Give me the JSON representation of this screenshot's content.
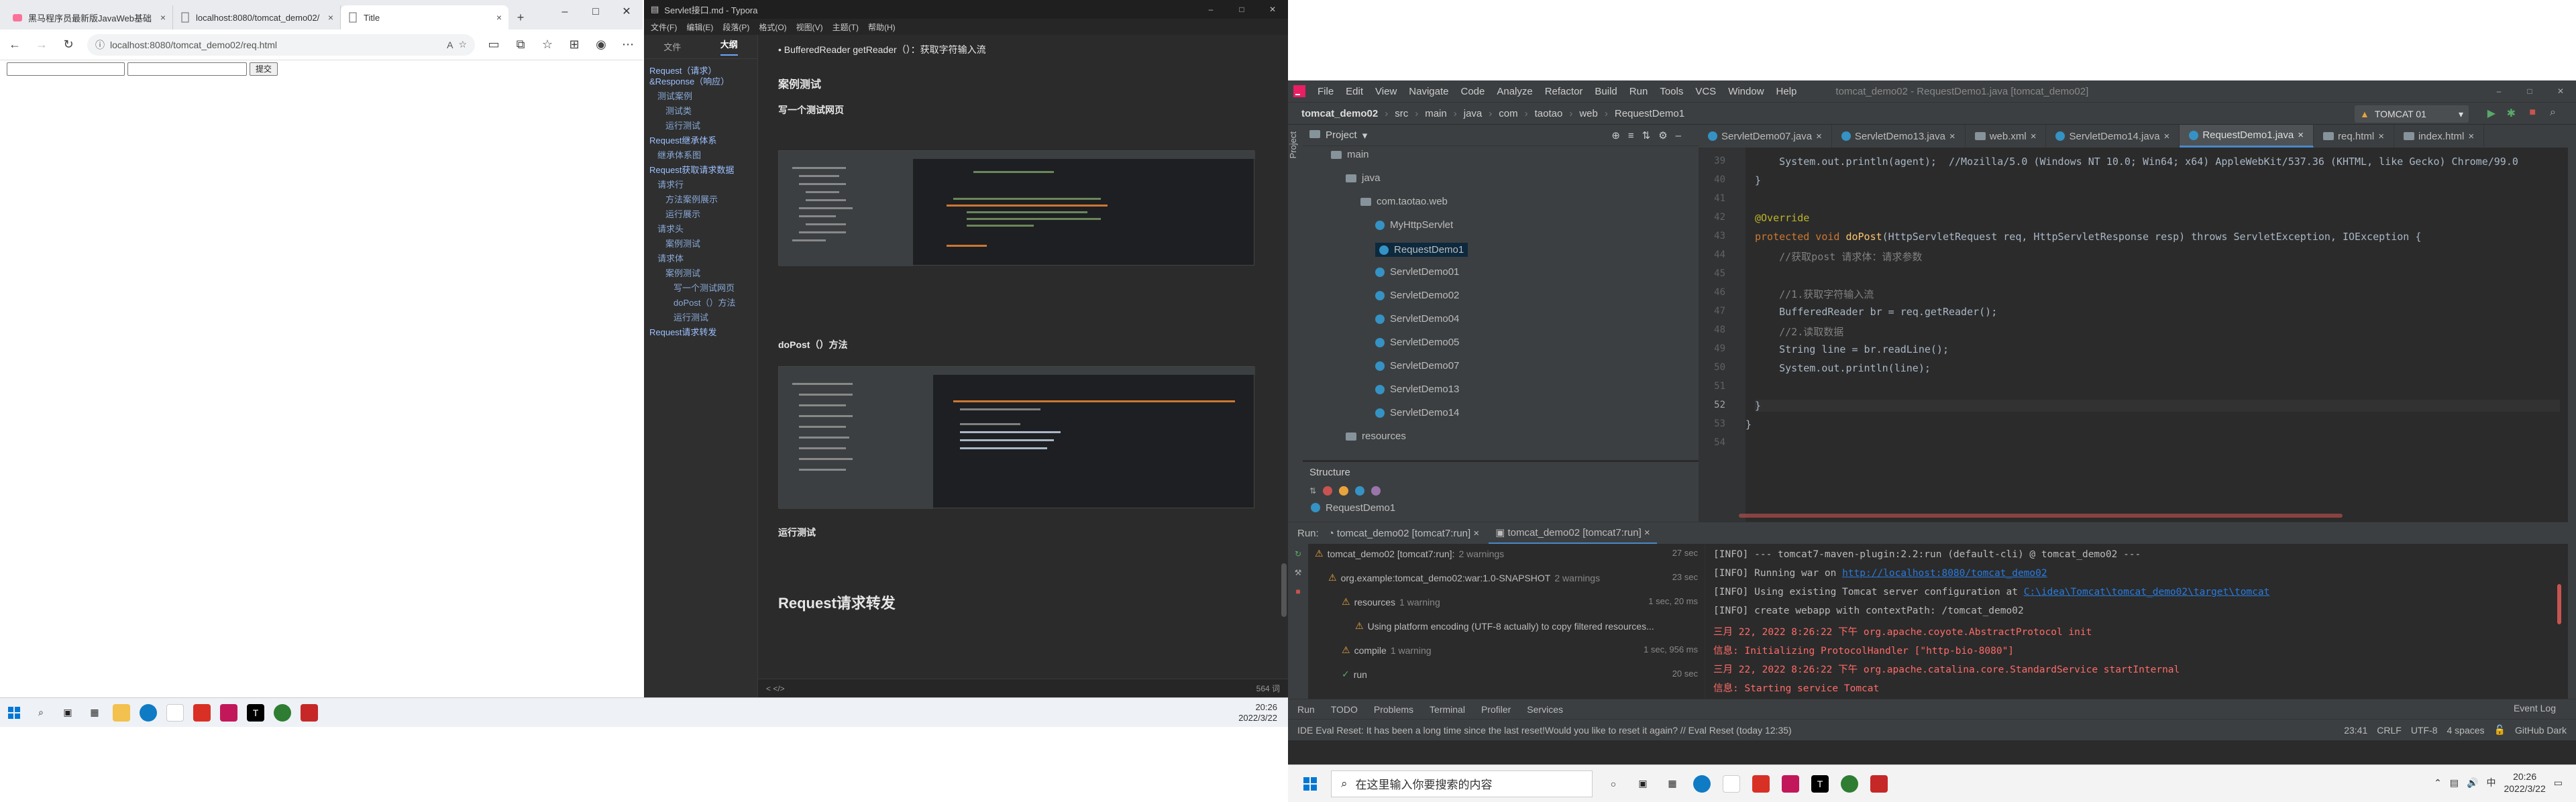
{
  "browser": {
    "tabs": [
      {
        "title": "黑马程序员最新版JavaWeb基础",
        "icon": "bilibili-icon"
      },
      {
        "title": "localhost:8080/tomcat_demo02/",
        "icon": "page-icon"
      },
      {
        "title": "Title",
        "icon": "page-icon"
      }
    ],
    "new_tab": "+",
    "address": "localhost:8080/tomcat_demo02/req.html",
    "submit_label": "提交"
  },
  "typora": {
    "title": "Servlet接口.md - Typora",
    "menu": [
      "文件(F)",
      "编辑(E)",
      "段落(P)",
      "格式(O)",
      "视图(V)",
      "主题(T)",
      "帮助(H)"
    ],
    "side_tabs": [
      "文件",
      "大纲"
    ],
    "outline": [
      {
        "text": "Request（请求）&Response（响应）",
        "level": 0
      },
      {
        "text": "测试案例",
        "level": 1
      },
      {
        "text": "测试类",
        "level": 2
      },
      {
        "text": "运行测试",
        "level": 2
      },
      {
        "text": "Request继承体系",
        "level": 0
      },
      {
        "text": "继承体系图",
        "level": 1
      },
      {
        "text": "Request获取请求数据",
        "level": 0
      },
      {
        "text": "请求行",
        "level": 1
      },
      {
        "text": "方法案例展示",
        "level": 2
      },
      {
        "text": "运行展示",
        "level": 2
      },
      {
        "text": "请求头",
        "level": 1
      },
      {
        "text": "案例测试",
        "level": 2
      },
      {
        "text": "请求体",
        "level": 1
      },
      {
        "text": "案例测试",
        "level": 2
      },
      {
        "text": "写一个测试网页",
        "level": 3
      },
      {
        "text": "doPost（）方法",
        "level": 3
      },
      {
        "text": "运行测试",
        "level": 3
      },
      {
        "text": "Request请求转发",
        "level": 0
      }
    ],
    "doc": {
      "bullet": "BufferedReader getReader（）：获取字符输入流",
      "h_case": "案例测试",
      "h_web": "写一个测试网页",
      "h_dopost": "doPost（）方法",
      "h_run": "运行测试",
      "h_forward": "Request请求转发"
    },
    "status_words": "564 词",
    "status_left": "< </>"
  },
  "taskbar_small": {
    "time": "20:26",
    "date": "2022/3/22"
  },
  "ide": {
    "menu": [
      "File",
      "Edit",
      "View",
      "Navigate",
      "Code",
      "Analyze",
      "Refactor",
      "Build",
      "Run",
      "Tools",
      "VCS",
      "Window",
      "Help"
    ],
    "window_title": "tomcat_demo02 - RequestDemo1.java [tomcat_demo02]",
    "breadcrumb": [
      "tomcat_demo02",
      "src",
      "main",
      "java",
      "com",
      "taotao",
      "web",
      "RequestDemo1"
    ],
    "run_config": "TOMCAT 01",
    "project_label": "Project",
    "tree": [
      {
        "label": "main",
        "kind": "folder",
        "indent": 1
      },
      {
        "label": "java",
        "kind": "folder",
        "indent": 2
      },
      {
        "label": "com.taotao.web",
        "kind": "folder",
        "indent": 3
      },
      {
        "label": "MyHttpServlet",
        "kind": "class",
        "indent": 4
      },
      {
        "label": "RequestDemo1",
        "kind": "class",
        "indent": 4
      },
      {
        "label": "ServletDemo01",
        "kind": "class",
        "indent": 4
      },
      {
        "label": "ServletDemo02",
        "kind": "class",
        "indent": 4
      },
      {
        "label": "ServletDemo04",
        "kind": "class",
        "indent": 4
      },
      {
        "label": "ServletDemo05",
        "kind": "class",
        "indent": 4
      },
      {
        "label": "ServletDemo07",
        "kind": "class",
        "indent": 4
      },
      {
        "label": "ServletDemo13",
        "kind": "class",
        "indent": 4
      },
      {
        "label": "ServletDemo14",
        "kind": "class",
        "indent": 4
      },
      {
        "label": "resources",
        "kind": "folder",
        "indent": 2
      }
    ],
    "structure_label": "Structure",
    "structure_item": "RequestDemo1",
    "editor_tabs": [
      "ServletDemo07.java",
      "ServletDemo13.java",
      "web.xml",
      "ServletDemo14.java",
      "RequestDemo1.java",
      "req.html",
      "index.html"
    ],
    "active_tab": "RequestDemo1.java",
    "line_numbers": [
      "39",
      "40",
      "41",
      "42",
      "43",
      "44",
      "45",
      "46",
      "47",
      "48",
      "49",
      "50",
      "51",
      "52",
      "53",
      "54"
    ],
    "code": {
      "l39": "    System.out.println(agent);  //Mozilla/5.0 (Windows NT 10.0; Win64; x64) AppleWebKit/537.36 (KHTML, like Gecko) Chrome/99.0",
      "l40": "}",
      "l42": "@Override",
      "l43a": "protected void ",
      "l43b": "doPost",
      "l43c": "(HttpServletRequest req, HttpServletResponse resp) throws ServletException, IOException {",
      "l44": "    //获取post 请求体：请求参数",
      "l46": "    //1.获取字符输入流",
      "l47": "    BufferedReader br = req.getReader();",
      "l48": "    //2.读取数据",
      "l49": "    String line = br.readLine();",
      "l50": "    System.out.println(line);",
      "l52": "}",
      "l53": "}"
    },
    "run": {
      "tab_label": "Run:",
      "tab1": "tomcat_demo02 [tomcat7:run]",
      "tab2": "tomcat_demo02 [tomcat7:run]",
      "tree": [
        {
          "label": "tomcat_demo02 [tomcat7:run]:",
          "extra": "2 warnings",
          "time": "27 sec"
        },
        {
          "label": "org.example:tomcat_demo02:war:1.0-SNAPSHOT",
          "extra": "2 warnings",
          "time": "23 sec"
        },
        {
          "label": "resources",
          "extra": "1 warning",
          "time": "1 sec, 20 ms"
        },
        {
          "label": "Using platform encoding (UTF-8 actually) to copy filtered resources...",
          "extra": "",
          "time": ""
        },
        {
          "label": "compile",
          "extra": "1 warning",
          "time": "1 sec, 956 ms"
        },
        {
          "label": "run",
          "extra": "",
          "time": "20 sec"
        }
      ],
      "console": [
        "[INFO] --- tomcat7-maven-plugin:2.2:run (default-cli) @ tomcat_demo02 ---",
        "[INFO] Running war on ",
        "[INFO] Using existing Tomcat server configuration at ",
        "[INFO] create webapp with contextPath: /tomcat_demo02",
        "三月 22, 2022 8:26:22 下午 org.apache.coyote.AbstractProtocol init",
        "信息: Initializing ProtocolHandler [\"http-bio-8080\"]",
        "三月 22, 2022 8:26:22 下午 org.apache.catalina.core.StandardService startInternal",
        "信息: Starting service Tomcat"
      ],
      "link1": "http://localhost:8080/tomcat_demo02",
      "link2": "C:\\idea\\Tomcat\\tomcat_demo02\\target\\tomcat"
    },
    "bottom_tabs": [
      "Run",
      "TODO",
      "Problems",
      "Terminal",
      "Profiler",
      "Services"
    ],
    "event_log": "Event Log",
    "status_msg": "IDE Eval Reset: It has been a long time since the last reset!Would you like to reset it again? // Eval Reset (today 12:35)",
    "status_right": [
      "23:41",
      "CRLF",
      "UTF-8",
      "4 spaces"
    ],
    "github_theme": "GitHub Dark"
  },
  "taskbar_main": {
    "search_placeholder": "在这里输入你要搜索的内容",
    "time": "20:26",
    "date": "2022/3/22"
  }
}
